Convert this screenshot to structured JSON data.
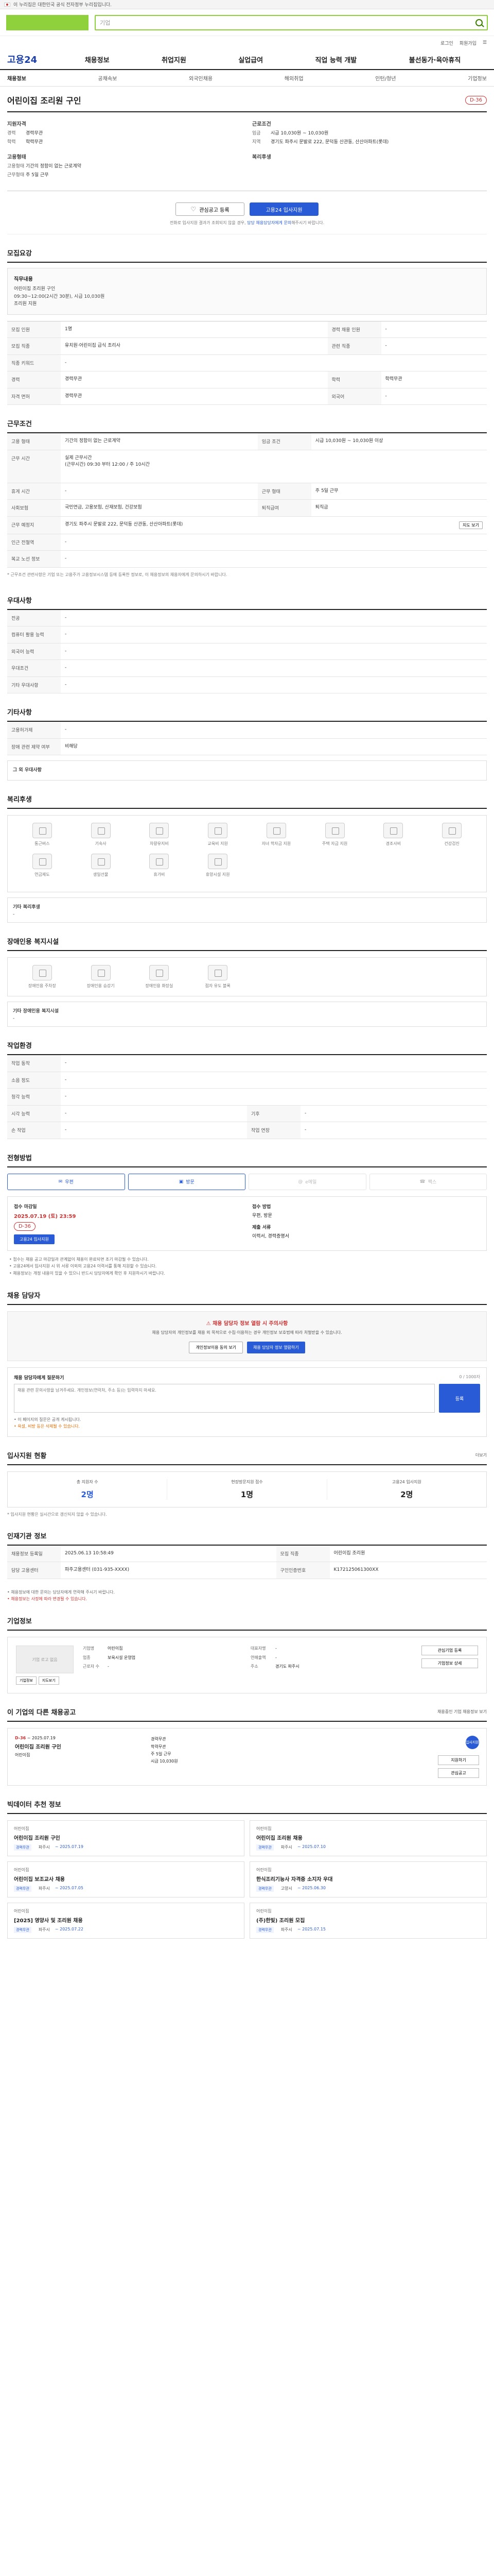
{
  "gov_banner": {
    "text": "이 누리집은 대한민국 공식 전자정부 누리집입니다.",
    "toggle": ""
  },
  "header": {
    "logo": "",
    "search_placeholder": "기업",
    "login": "로그인",
    "join": "회원가입",
    "menu": "☰"
  },
  "gnb": {
    "brand": "고용24",
    "menu": [
      "채용정보",
      "취업지원",
      "실업급여",
      "직업 능력 개발",
      "불선동가·육아휴직"
    ]
  },
  "subnav": [
    "채용정보",
    "공채속보",
    "외국인채용",
    "해외취업",
    "인턴/청년",
    "기업정보"
  ],
  "job": {
    "title": "어린이집 조리원 구인",
    "dday": "D-36",
    "overview": {
      "left": {
        "career_title": "지원자격",
        "career": [
          {
            "k": "경력",
            "v": "경력무관"
          },
          {
            "k": "학력",
            "v": "학력무관"
          }
        ],
        "emp_title": "고용형태",
        "emp": [
          {
            "k": "고용형태",
            "v": "기간의 정함이 없는 근로계약"
          },
          {
            "k": "근무형태",
            "v": "주 5일 근무"
          }
        ]
      },
      "right": {
        "cond_title": "근로조건",
        "cond": [
          {
            "k": "임금",
            "v": "시급 10,030원 ~ 10,030원"
          },
          {
            "k": "지역",
            "v": "경기도 파주시 문발로 222, 문덕동 산관동, 산산아파트(롯데)"
          }
        ],
        "welfare_title": "복리후생"
      }
    },
    "buttons": {
      "favorite": "관심공고 등록",
      "apply": "고용24 입사지원"
    },
    "note_pre": "전화로 입사지원 결과가 조회되지 않을 경우, ",
    "note_link": "담당 채용담당자에게 문의",
    "note_post": "해주시기 바랍니다."
  },
  "sections": {
    "recruit_title": "모집요강",
    "recruit_box_title": "직무내용",
    "recruit_box_lines": [
      "어린이집 조리원 구인",
      "09:30~12:00(2시간 30분), 시급 10,030원",
      "조리원 지원"
    ],
    "recruit_table": [
      {
        "k": "모집 인원",
        "v": "1명",
        "k2": "경력 채용 인원",
        "v2": "-"
      },
      {
        "k": "모집 직종",
        "v": "유치원·어린이집 급식 조리사",
        "k2": "관련 직종",
        "v2": "-"
      },
      {
        "k": "직종 키워드",
        "v": "-",
        "k2": "",
        "v2": ""
      },
      {
        "k": "경력",
        "v": "경력무관",
        "k2": "학력",
        "v2": "학력무관"
      },
      {
        "k": "자격 면허",
        "v": "경력무관",
        "k2": "외국어",
        "v2": "-"
      }
    ],
    "work_title": "근무조건",
    "work_table": [
      {
        "k": "고용 형태",
        "v": "기간의 정함이 없는 근로계약",
        "k2": "임금 조건",
        "v2": "시급 10,030원 ~ 10,030원 이상"
      },
      {
        "k": "근무 시간",
        "v": "실제 근무시간\n(근무시간) 09:30 부터 12:00 / 주 10시간",
        "k2": "",
        "v2": ""
      },
      {
        "k": "휴게 시간",
        "v": "-",
        "k2": "근무 형태",
        "v2": "주 5일 근무"
      },
      {
        "k": "사회보험",
        "v": "국민연금, 고용보험, 산재보험, 건강보험",
        "k2": "퇴직급여",
        "v2": "퇴직금"
      },
      {
        "k": "근무 예정지",
        "v": "경기도 파주시 문발로 222, 문덕동 산관동, 산산아파트(롯데)",
        "k2": "",
        "v2": ""
      },
      {
        "k": "인근 전철역",
        "v": "-",
        "k2": "",
        "v2": ""
      },
      {
        "k": "복교 노선 정보",
        "v": "-",
        "k2": "",
        "v2": ""
      }
    ],
    "map_btn": "지도 보기",
    "work_foot": "* 근무조건 관련사항은 기업 또는 고용주가 고용정보시스템 등에 등록한 정보로, 이 채용정보의 채용자에게 문의하시기 바랍니다.",
    "prefer_title": "우대사항",
    "prefer_table": [
      {
        "k": "전공",
        "v": "-"
      },
      {
        "k": "컴퓨터 활용 능력",
        "v": "-"
      },
      {
        "k": "외국어 능력",
        "v": "-"
      },
      {
        "k": "우대조건",
        "v": "-"
      },
      {
        "k": "기타 우대사항",
        "v": "-"
      }
    ],
    "other_title": "기타사항",
    "other_table": [
      {
        "k": "고용허가제",
        "v": "-"
      },
      {
        "k": "장애 관련 제약 여부",
        "v": "비해당"
      }
    ],
    "other_box_title": "그 외 우대사항",
    "welfare_title": "복리후생",
    "welfare_items": [
      "통근버스",
      "기숙사",
      "차량유지비",
      "교육비 지원",
      "자녀 학자금 지원",
      "주택 자금 지원",
      "경조사비",
      "건강검진",
      "연금제도",
      "생일선물",
      "휴가비",
      "휴양시설 지원"
    ],
    "welfare_extra_title": "기타 복리후생",
    "welfare_extra_value": "-",
    "disability_title": "장애인용 복지시설",
    "disability_items": [
      "장애인용 주차장",
      "장애인용 승강기",
      "장애인용 화장실",
      "점자 유도 블록"
    ],
    "disability_extra_title": "기타 장애인용 복지시설",
    "disability_extra_value": "-",
    "env_title": "작업환경",
    "env_table": [
      {
        "k": "작업 동작",
        "v": "-",
        "k2": "",
        "v2": ""
      },
      {
        "k": "소음 정도",
        "v": "-",
        "k2": "",
        "v2": ""
      },
      {
        "k": "청각 능력",
        "v": "-",
        "k2": "",
        "v2": ""
      },
      {
        "k": "시각 능력",
        "v": "-",
        "k2": "기후",
        "v2": "-"
      },
      {
        "k": "손 작업",
        "v": "-",
        "k2": "작업 연장",
        "v2": "-"
      }
    ]
  },
  "apply": {
    "title": "전형방법",
    "methods": [
      {
        "label": "우편",
        "state": "on"
      },
      {
        "label": "방문",
        "state": "on"
      },
      {
        "label": "e메일",
        "state": "off"
      },
      {
        "label": "팩스",
        "state": "off"
      }
    ],
    "deadline_title": "접수 마감일",
    "deadline_value": "2025.07.19 (토) 23:59",
    "deadline_hint": "D-36",
    "apply_btn": "고용24 입사지원",
    "method_title": "접수 방법",
    "method_value": "우편, 방문",
    "docs_title": "제출 서류",
    "docs_value": "이력서, 경력증명서",
    "notices": [
      "• 접수는 채용 공고 마감일과 관계없이 채용이 완료되면 조기 마감될 수 있습니다.",
      "• 고용24에서 입사지원 시 위 서류 이외의 고용24 이력서를 통해 지원할 수 있습니다.",
      "• 채용정보는 개정 내용이 있을 수 있으니 반드시 담당자에게 확인 후 지원하시기 바랍니다."
    ]
  },
  "contact": {
    "title": "채용 담당자",
    "alert_head": "채용 담당자 정보 열람 시 주의사항",
    "alert_text": "채용 담당자의 개인정보를 채용 외 목적으로 수집·이용하는 경우 개인정보 보호법에 따라 처벌받을 수 있습니다.",
    "btn_view": "개인정보이용 동의 보기",
    "btn_confirm": "채용 담당자 정보 열람하기",
    "qa_title": "채용 담당자에게 질문하기",
    "qa_count": "0 / 1000자",
    "qa_placeholder": "채용 관련 문의사항을 남겨주세요. 개인정보(연락처, 주소 등)는 입력하지 마세요.",
    "qa_submit": "등록",
    "qa_notes": [
      "• 이 페이지의 질문은 공개 게시됩니다.",
      "• 욕설, 비방 등은 삭제될 수 있습니다."
    ]
  },
  "stats": {
    "title": "입사지원 현황",
    "more": "더보기",
    "items": [
      {
        "label": "총 지원자 수",
        "value": "2명",
        "dark": false
      },
      {
        "label": "현장방문지원 접수",
        "value": "1명",
        "dark": true
      },
      {
        "label": "고용24 입사지원",
        "value": "2명",
        "dark": true
      }
    ],
    "note": "* 입사지원 현황은 실시간으로 갱신되지 않을 수 있습니다."
  },
  "recruit_info": {
    "title": "인재기관 정보",
    "table": [
      {
        "k": "채용정보 등록일",
        "v": "2025.06.13 10:58:49",
        "k2": "모집 직종",
        "v2": "어린이집 조리원"
      },
      {
        "k": "담당 고용센터",
        "v": "파주고용센터 (031-935-XXXX)",
        "k2": "구인인증번호",
        "v2": "K172125061300XX"
      }
    ],
    "foot": [
      "• 채용정보에 대한 문의는 담당자에게 연락해 주시기 바랍니다.",
      "• 채용정보는 사정에 따라 변경될 수 있습니다."
    ]
  },
  "company": {
    "title": "기업정보",
    "logo_alt": "기업 로고 없음",
    "mini": [
      "기업정보",
      "지도보기"
    ],
    "col1": [
      {
        "k": "기업명",
        "v": "어린이집"
      },
      {
        "k": "업종",
        "v": "보육시설 운영업"
      },
      {
        "k": "근로자 수",
        "v": "-"
      }
    ],
    "col2": [
      {
        "k": "대표자명",
        "v": "-"
      },
      {
        "k": "연매출액",
        "v": "-"
      },
      {
        "k": "주소",
        "v": "경기도 파주시"
      }
    ],
    "btns": [
      "관심기업 등록",
      "기업정보 상세"
    ]
  },
  "other_jobs": {
    "title": "이 기업의 다른 채용공고",
    "more": "채용중인 기업 채용정보 보기",
    "dday": "D-36",
    "period": "~ 2025.07.19",
    "job_title": "어린이집 조리원 구인",
    "company": "어린이집",
    "lines": [
      "경력무관",
      "학력무관",
      "주 5일 근무",
      "시급 10,030원"
    ],
    "btns": [
      "지원하기",
      "관심공고"
    ],
    "badge": "입사지원"
  },
  "recommended": {
    "title": "빅데이터 추천 정보",
    "cards": [
      {
        "company": "어린이집",
        "title": "어린이집 조리원 구인",
        "tag": "경력무관",
        "date": "~ 2025.07.19",
        "loc": "파주시"
      },
      {
        "company": "어린이집",
        "title": "어린이집 조리원 채용",
        "tag": "경력무관",
        "date": "~ 2025.07.10",
        "loc": "파주시"
      },
      {
        "company": "어린이집",
        "title": "어린이집 보조교사 채용",
        "tag": "경력무관",
        "date": "~ 2025.07.05",
        "loc": "파주시"
      },
      {
        "company": "어린이집",
        "title": "한식조리기능사 자격증 소지자 우대",
        "tag": "경력무관",
        "date": "~ 2025.06.30",
        "loc": "고양시"
      },
      {
        "company": "어린이집",
        "title": "[2025] 영양사 및 조리원 채용",
        "tag": "경력무관",
        "date": "~ 2025.07.22",
        "loc": "파주시"
      },
      {
        "company": "어린이집",
        "title": "(주)한빛) 조리원 모집",
        "tag": "경력무관",
        "date": "~ 2025.07.15",
        "loc": "파주시"
      }
    ]
  }
}
